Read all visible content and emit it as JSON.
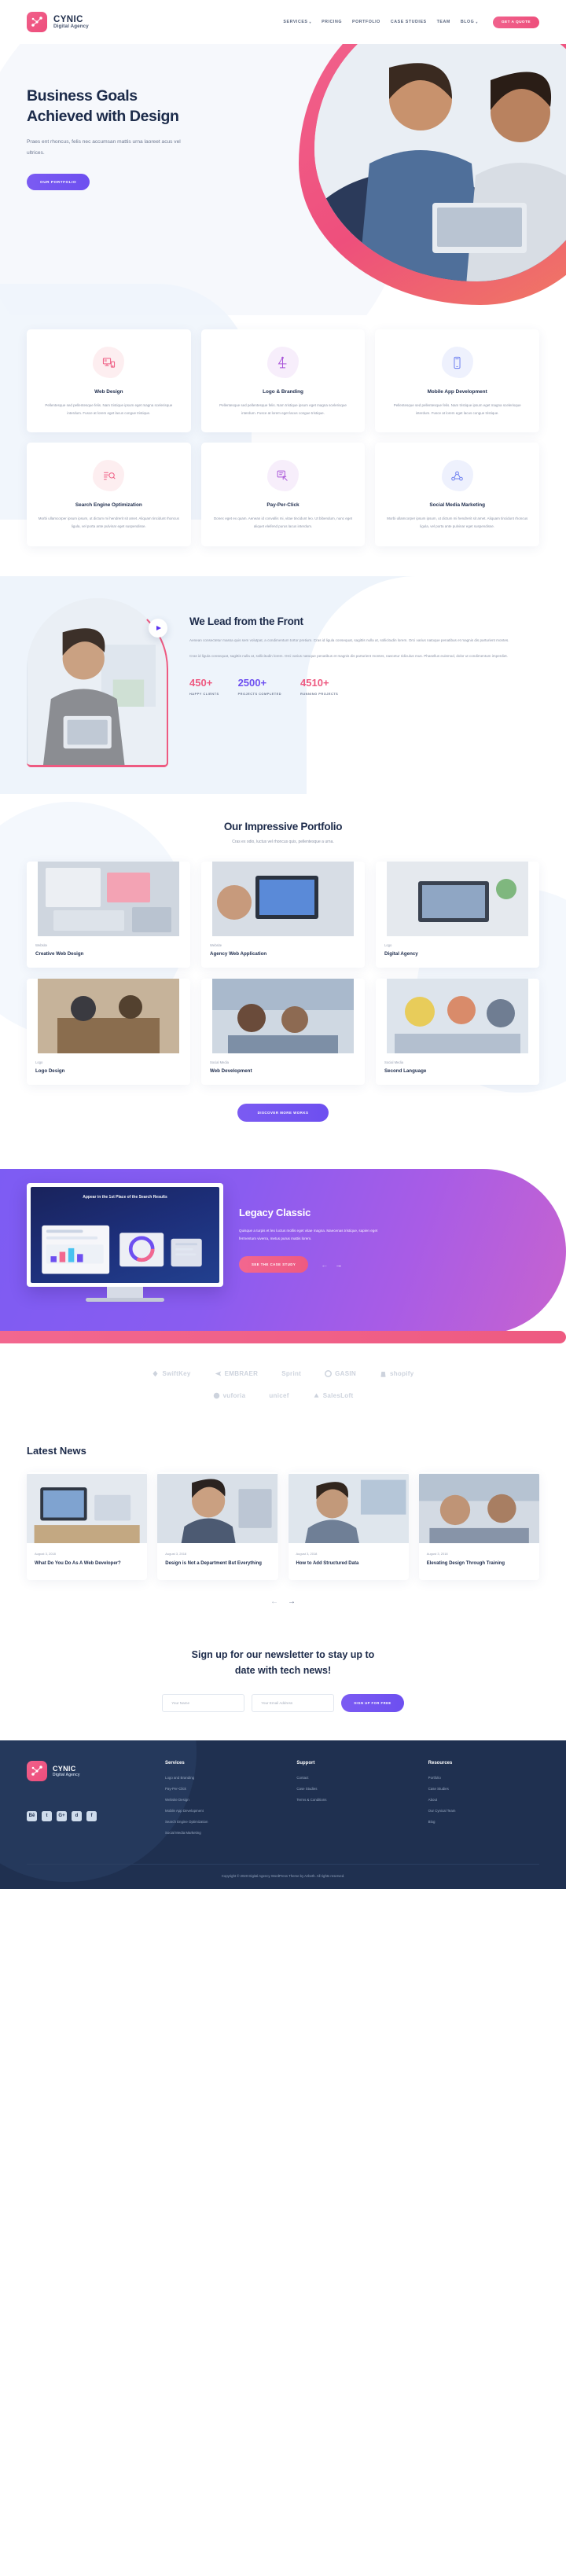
{
  "brand": {
    "name": "CYNIC",
    "tagline": "Digital Agency"
  },
  "nav": {
    "items": [
      {
        "label": "SERVICES",
        "has_caret": true
      },
      {
        "label": "PRICING",
        "has_caret": false
      },
      {
        "label": "PORTFOLIO",
        "has_caret": false
      },
      {
        "label": "CASE STUDIES",
        "has_caret": false
      },
      {
        "label": "TEAM",
        "has_caret": false
      },
      {
        "label": "BLOG",
        "has_caret": true
      }
    ],
    "cta": "GET A QUOTE"
  },
  "hero": {
    "title_line1": "Business Goals",
    "title_line2": "Achieved with Design",
    "subtitle": "Praes ent rhoncus, felis nec accumsan mattis urna laoreet acus vel ultrices.",
    "button": "OUR PORTFOLIO"
  },
  "services": [
    {
      "icon": "web-design-icon",
      "tone": "pink",
      "title": "Web Design",
      "desc": "Pellentesque sed pellentesque felis. Nam tristique ipsum eget magna scelerisque interdum. Fusce at lorem eget lacus congue tristique."
    },
    {
      "icon": "logo-branding-icon",
      "tone": "purple",
      "title": "Logo & Branding",
      "desc": "Pellentesque sed pellentesque felis. Nam tristique ipsum eget magna scelerisque interdum. Fusce at lorem eget lacus congue tristique."
    },
    {
      "icon": "mobile-app-icon",
      "tone": "blue",
      "title": "Mobile App Development",
      "desc": "Pellentesque sed pellentesque felis. Nam tristique ipsum eget magna scelerisque interdum. Fusce at lorem eget lacus congue tristique."
    },
    {
      "icon": "seo-icon",
      "tone": "pink",
      "title": "Search Engine Optimization",
      "desc": "Morbi ullamcorper ipsum ipsum, ut dictum mi hendrerit sit amet. Aliquam tincidunt rhoncus ligula, vel porta ante pulvinar eget suspendisse."
    },
    {
      "icon": "ppc-icon",
      "tone": "purple",
      "title": "Pay-Per-Click",
      "desc": "Donec eget ex quam. Aenean id convallis mi, vitae tincidunt leo. Ut bibendum, nunc eget aliquet eleifend purus lacus interdum."
    },
    {
      "icon": "social-media-icon",
      "tone": "blue",
      "title": "Social Media Marketing",
      "desc": "Morbi ullamcorper ipsum ipsum, ut dictum mi hendrerit sit amet. Aliquam tincidunt rhoncus ligula, vel porta ante pulvinar eget suspendisse."
    }
  ],
  "lead": {
    "title": "We Lead from the Front",
    "p1": "Aenean consectetur massa quis sem volutpat, a condimentum tortor pretium. Cras id ligula consequat, sagittis nulla at, sollicitudin lorem. Orci varius natoque penatibus et magnis dis parturient montes.",
    "p2": "Cras id ligula consequat, sagittis nulla at, sollicitudin lorem. Orci varius natoque penatibus et magnis dis parturient montes, nascetur ridiculus mus. Phasellus euismod, dolor ut condimentum imperdiet.",
    "play_button": "play-icon",
    "stats": [
      {
        "value": "450+",
        "label": "HAPPY CLIENTS"
      },
      {
        "value": "2500+",
        "label": "PROJECTS COMPLETED"
      },
      {
        "value": "4510+",
        "label": "RUNNING PROJECTS"
      }
    ]
  },
  "portfolio": {
    "title": "Our Impressive Portfolio",
    "subtitle": "Cras ex odio, luctus vel rhoncus quis, pellentesque a urna.",
    "items": [
      {
        "category": "Website",
        "name": "Creative Web Design"
      },
      {
        "category": "Website",
        "name": "Agency Web Application"
      },
      {
        "category": "Logo",
        "name": "Digital Agency"
      },
      {
        "category": "Logo",
        "name": "Logo Design"
      },
      {
        "category": "Social Media",
        "name": "Web Development"
      },
      {
        "category": "Social Media",
        "name": "Second Language"
      }
    ],
    "button": "DISCOVER MORE WORKS"
  },
  "legacy": {
    "title": "Legacy Classic",
    "desc": "Quisque a turpis et leo luctus mollis eget vitae magna. Maecenas tristique, sapien eget fermentum viverra, metus purus mattis lorem.",
    "button": "SEE THE CASE STUDY",
    "monitor_title": "Appear in the 1st Place of the Search Results",
    "prev_arrow": "arrow-left-icon",
    "next_arrow": "arrow-right-icon"
  },
  "brands": {
    "row1": [
      "SwiftKey",
      "EMBRAER",
      "Sprint",
      "GASIN",
      "shopify"
    ],
    "row2": [
      "vuforia",
      "unicef",
      "SalesLoft"
    ]
  },
  "news": {
    "title": "Latest News",
    "items": [
      {
        "date": "August 3, 2018",
        "title": "What Do You Do As A Web Developer?"
      },
      {
        "date": "August 3, 2018",
        "title": "Design is Not a Department But Everything"
      },
      {
        "date": "August 3, 2018",
        "title": "How to Add Structured Data"
      },
      {
        "date": "August 3, 2018",
        "title": "Elevating Design Through Training"
      }
    ],
    "prev_arrow": "arrow-left-icon",
    "next_arrow": "arrow-right-icon"
  },
  "newsletter": {
    "title_line1": "Sign up for our newsletter to stay up to",
    "title_line2": "date with tech news!",
    "name_placeholder": "Your Name",
    "email_placeholder": "Your Email Address",
    "button": "SIGN UP FOR FREE"
  },
  "footer": {
    "brand": {
      "name": "CYNIC",
      "tagline": "Digital Agency"
    },
    "socials": [
      {
        "name": "behance-icon",
        "glyph": "Bē"
      },
      {
        "name": "twitter-icon",
        "glyph": "t"
      },
      {
        "name": "google-plus-icon",
        "glyph": "G+"
      },
      {
        "name": "dribbble-icon",
        "glyph": "d"
      },
      {
        "name": "facebook-icon",
        "glyph": "f"
      }
    ],
    "columns": [
      {
        "heading": "Services",
        "links": [
          "Logo and Branding",
          "Pay-Per-Click",
          "Website Design",
          "Mobile App Development",
          "Search Engine Optimization",
          "Social Media Marketing"
        ]
      },
      {
        "heading": "Support",
        "links": [
          "Contact",
          "Case Studies",
          "Terms & Conditions"
        ]
      },
      {
        "heading": "Resources",
        "links": [
          "Portfolio",
          "Case Studies",
          "About",
          "Our Cynical Team",
          "Blog"
        ]
      }
    ],
    "copyright": "Copyright © 2020 Digital Agency WordPress Theme by Azbeth. All rights reserved."
  },
  "colors": {
    "pink": "#ee5a81",
    "purple": "#6d4ff0",
    "dark": "#1d2b4a",
    "footer_bg": "#1f3050",
    "muted": "#8b93a6"
  }
}
